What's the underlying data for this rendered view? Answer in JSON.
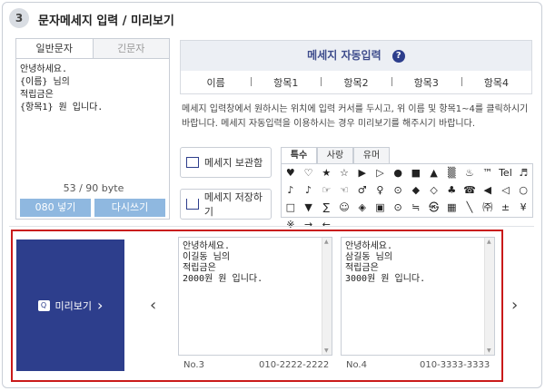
{
  "section": {
    "step": "3",
    "title": "문자메세지 입력 / 미리보기"
  },
  "editor": {
    "tabs": [
      "일반문자",
      "긴문자"
    ],
    "message": "안녕하세요.\n{이름} 님의\n적립금은\n{항목1} 원 입니다.",
    "bytes": "53 / 90 byte",
    "btn_080": "080 넣기",
    "btn_rewrite": "다시쓰기"
  },
  "auto_insert": {
    "title": "메세지 자동입력",
    "help": "?",
    "items": [
      "이름",
      "항목1",
      "항목2",
      "항목3",
      "항목4"
    ]
  },
  "description": "메세지 입력창에서 원하시는 위치에 입력 커서를 두시고, 위 이름 및 항목1~4를 클릭하시기 바랍니다. 메세지 자동입력을 이용하시는 경우 미리보기를 해주시기 바랍니다.",
  "side_buttons": {
    "storage": "메세지 보관함",
    "save": "메세지 저장하기"
  },
  "special": {
    "tabs": [
      "특수",
      "사랑",
      "유머"
    ],
    "chars": [
      "♥",
      "♡",
      "★",
      "☆",
      "▶",
      "▷",
      "●",
      "■",
      "▲",
      "▒",
      "♨",
      "™",
      "Tel",
      "♬",
      "♪",
      "♪",
      "☞",
      "☜",
      "♂",
      "♀",
      "⊙",
      "◆",
      "◇",
      "♣",
      "☎",
      "◀",
      "◁",
      "○",
      "□",
      "▼",
      "∑",
      "☺",
      "◈",
      "▣",
      "⊙",
      "≒",
      "㉿",
      "▦",
      "╲",
      "㈜",
      "±",
      "¥",
      "※",
      "→",
      "←"
    ]
  },
  "preview": {
    "button": "미리보기",
    "cards": [
      {
        "text": "안녕하세요.\n이길동 님의\n적립금은\n2000원 원 입니다.",
        "no": "No.3",
        "phone": "010-2222-2222"
      },
      {
        "text": "안녕하세요.\n삼길동 님의\n적립금은\n3000원 원 입니다.",
        "no": "No.4",
        "phone": "010-3333-3333"
      }
    ]
  },
  "colors": {
    "accent": "#2d3e8c",
    "highlight": "#c91a1a",
    "button_blue": "#8fb8e0"
  }
}
